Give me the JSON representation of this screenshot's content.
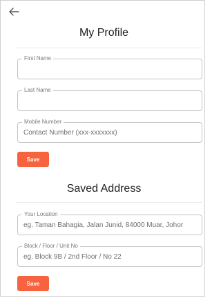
{
  "header": {
    "back_icon": "arrow-left-icon"
  },
  "profile": {
    "title": "My Profile",
    "first_name": {
      "label": "First Name",
      "value": "",
      "placeholder": ""
    },
    "last_name": {
      "label": "Last Name",
      "value": "",
      "placeholder": ""
    },
    "mobile": {
      "label": "Mobile Number",
      "value": "",
      "placeholder": "Contact Number (xxx-xxxxxxx)"
    },
    "save_label": "Save"
  },
  "address": {
    "title": "Saved Address",
    "location": {
      "label": "Your Location",
      "value": "",
      "placeholder": "eg. Taman Bahagia, Jalan Junid, 84000 Muar, Johor"
    },
    "block": {
      "label": "Block / Floor / Unit No",
      "value": "",
      "placeholder": "eg. Block 9B / 2nd Floor / No 22"
    },
    "save_label": "Save"
  },
  "colors": {
    "accent": "#f7623f",
    "border": "#c4c4c4",
    "text": "#1f1f1f",
    "label": "#7a7a7a"
  }
}
